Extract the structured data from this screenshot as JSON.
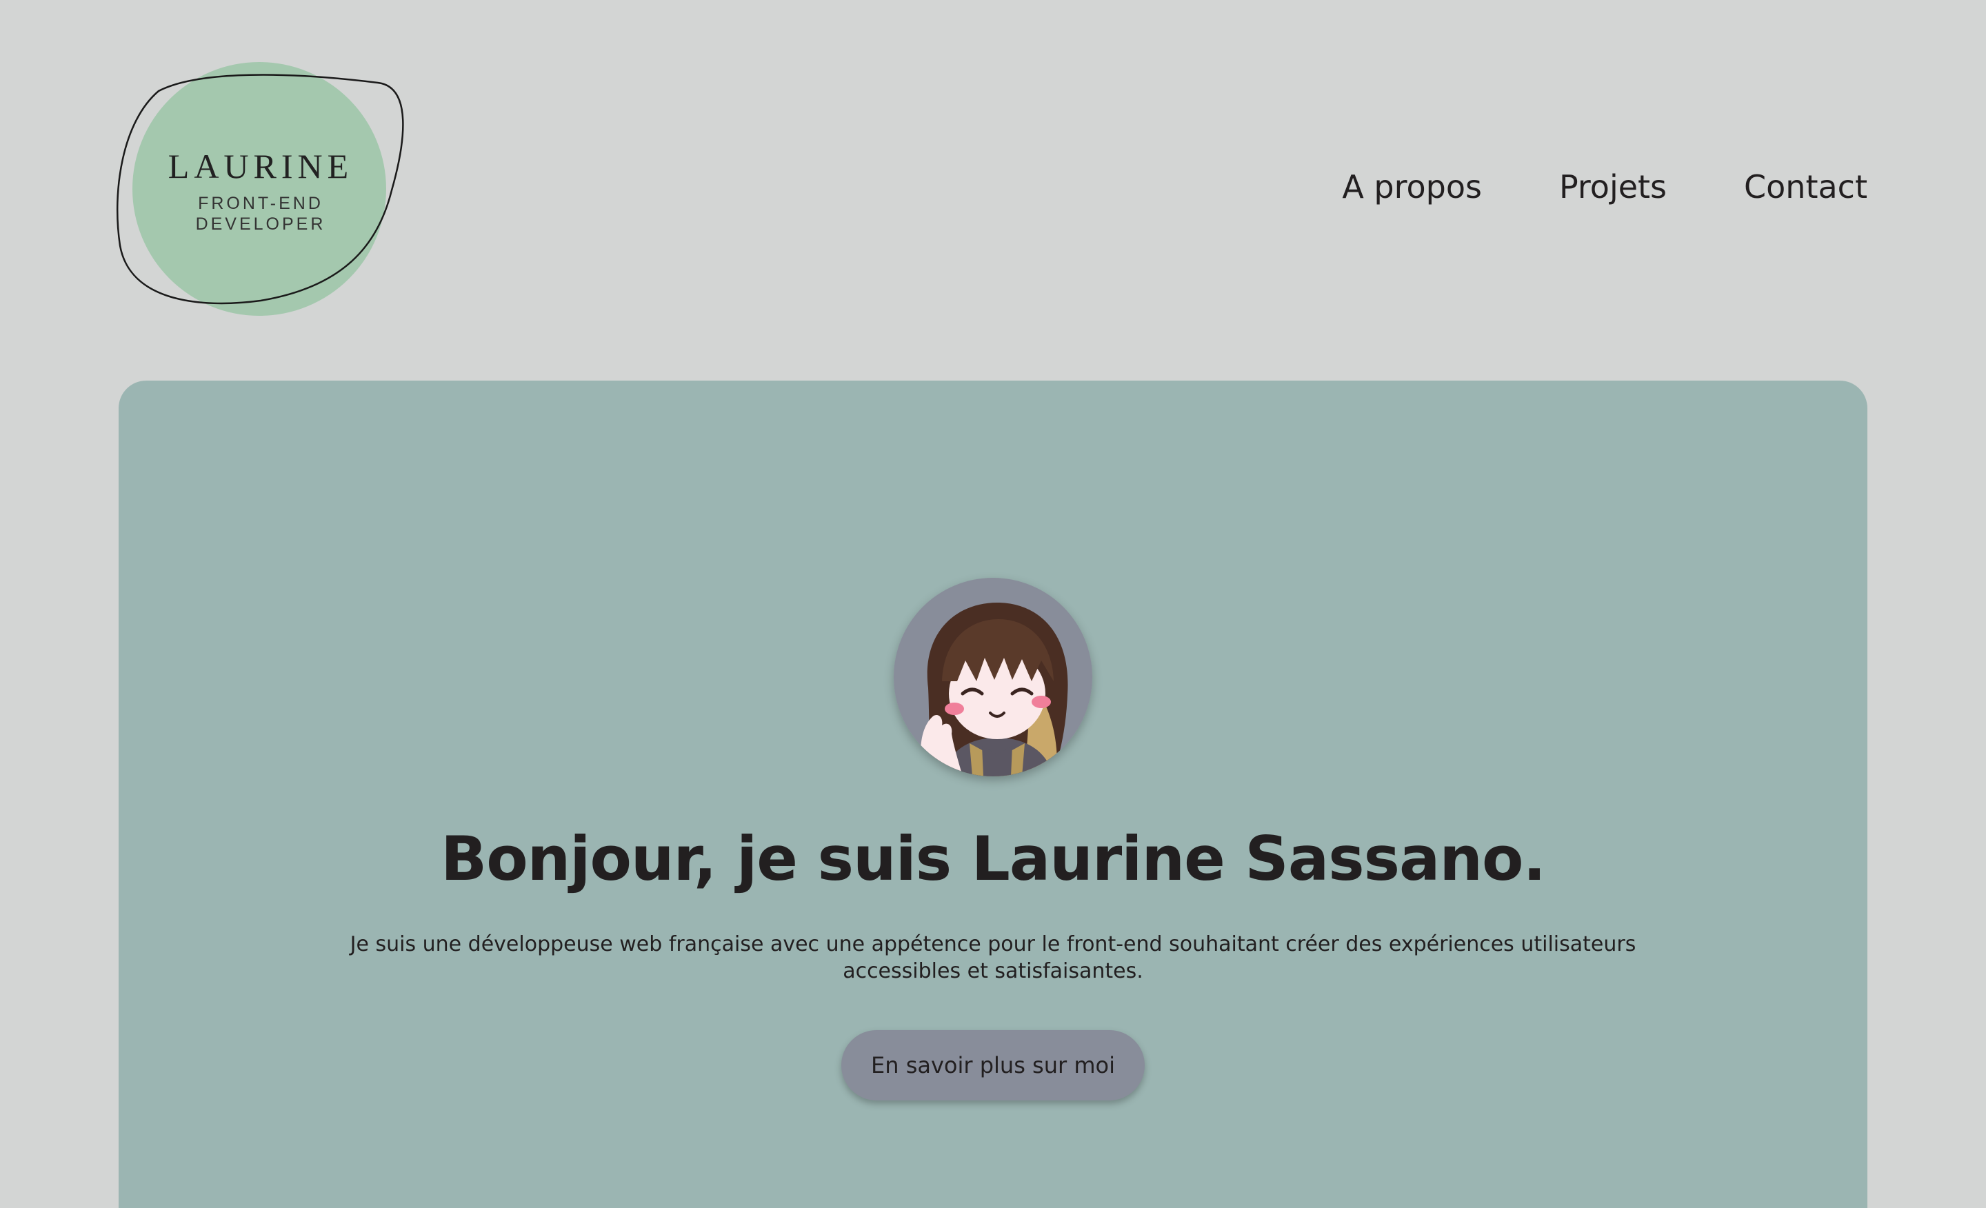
{
  "logo": {
    "name": "LAURINE",
    "subtitle_line1": "FRONT-END",
    "subtitle_line2": "DEVELOPER"
  },
  "nav": {
    "items": [
      {
        "label": "A propos"
      },
      {
        "label": "Projets"
      },
      {
        "label": "Contact"
      }
    ]
  },
  "hero": {
    "title": "Bonjour, je suis Laurine Sassano.",
    "description": "Je suis une développeuse web française avec une appétence pour le front-end souhaitant créer des expériences utilisateurs accessibles et satisfaisantes.",
    "button_label": "En savoir plus sur moi"
  },
  "colors": {
    "page_background": "#d3d5d4",
    "logo_circle": "#a4c8ae",
    "hero_background": "#9bb5b2",
    "button_background": "#888d9a",
    "text": "#221f20"
  }
}
